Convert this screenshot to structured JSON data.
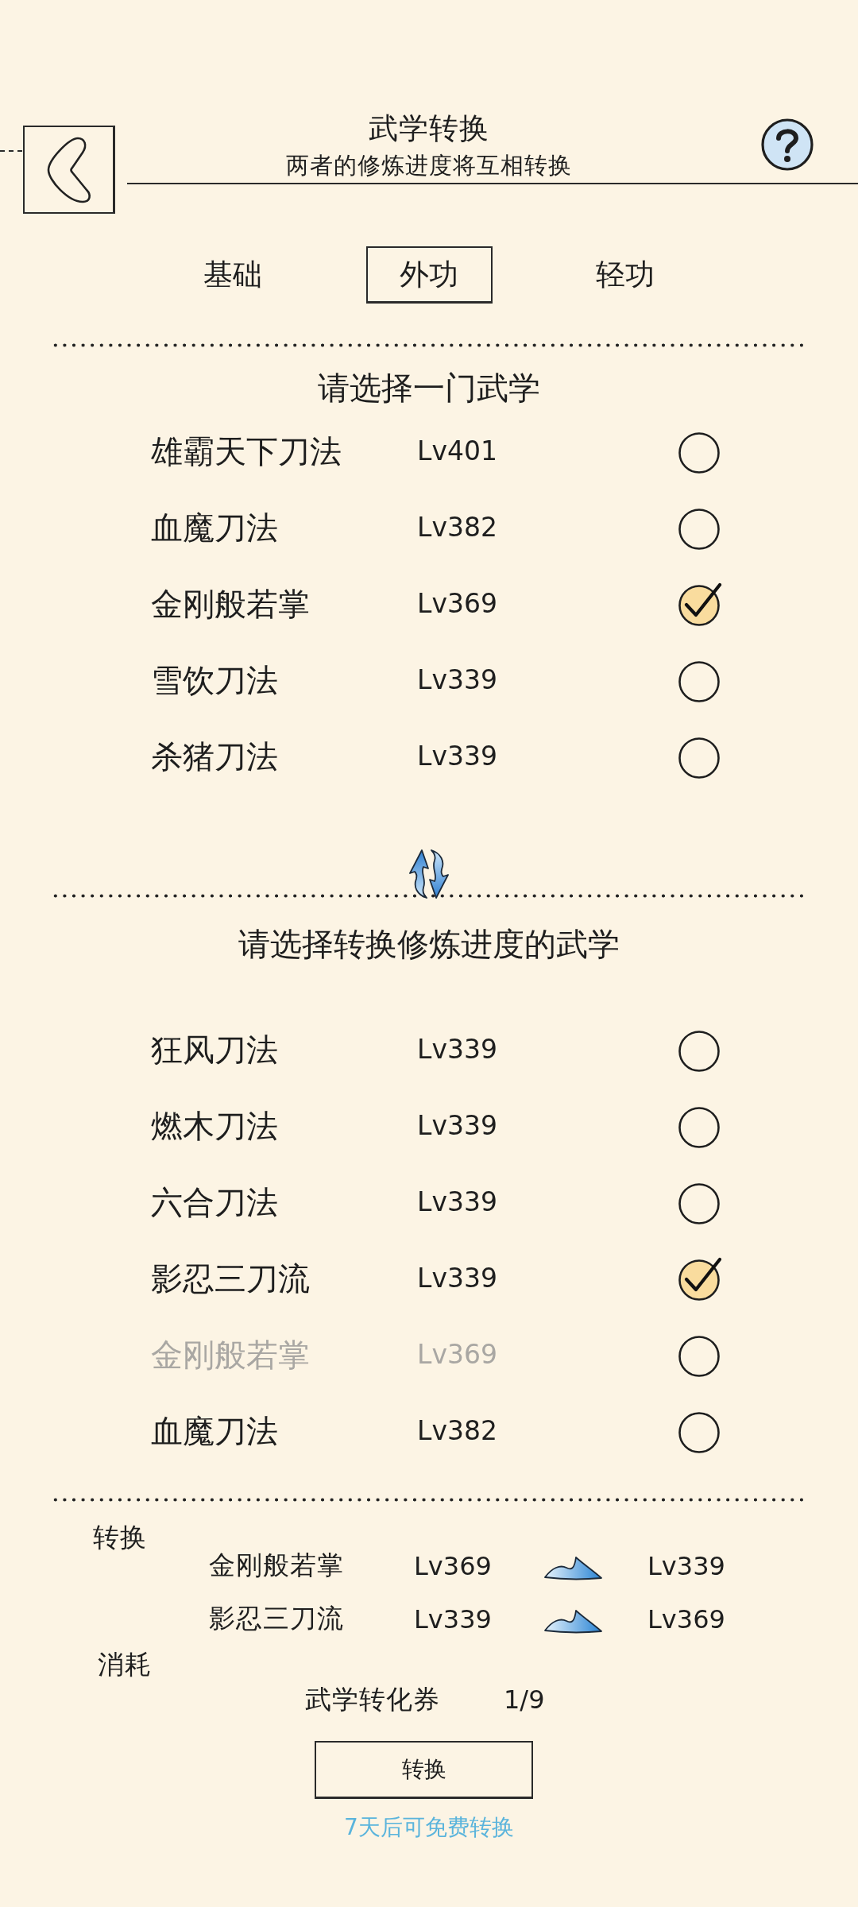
{
  "header": {
    "title": "武学转换",
    "subtitle": "两者的修炼进度将互相转换"
  },
  "tabs": [
    {
      "label": "基础",
      "selected": false
    },
    {
      "label": "外功",
      "selected": true
    },
    {
      "label": "轻功",
      "selected": false
    }
  ],
  "source_list": {
    "title": "请选择一门武学",
    "items": [
      {
        "name": "雄霸天下刀法",
        "level": "Lv401",
        "selected": false,
        "disabled": false
      },
      {
        "name": "血魔刀法",
        "level": "Lv382",
        "selected": false,
        "disabled": false
      },
      {
        "name": "金刚般若掌",
        "level": "Lv369",
        "selected": true,
        "disabled": false
      },
      {
        "name": "雪饮刀法",
        "level": "Lv339",
        "selected": false,
        "disabled": false
      },
      {
        "name": "杀猪刀法",
        "level": "Lv339",
        "selected": false,
        "disabled": false
      }
    ]
  },
  "target_list": {
    "title": "请选择转换修炼进度的武学",
    "items": [
      {
        "name": "狂风刀法",
        "level": "Lv339",
        "selected": false,
        "disabled": false
      },
      {
        "name": "燃木刀法",
        "level": "Lv339",
        "selected": false,
        "disabled": false
      },
      {
        "name": "六合刀法",
        "level": "Lv339",
        "selected": false,
        "disabled": false
      },
      {
        "name": "影忍三刀流",
        "level": "Lv339",
        "selected": true,
        "disabled": false
      },
      {
        "name": "金刚般若掌",
        "level": "Lv369",
        "selected": false,
        "disabled": true
      },
      {
        "name": "血魔刀法",
        "level": "Lv382",
        "selected": false,
        "disabled": false
      }
    ]
  },
  "conversion": {
    "label": "转换",
    "rows": [
      {
        "name": "金刚般若掌",
        "from_level": "Lv369",
        "to_level": "Lv339"
      },
      {
        "name": "影忍三刀流",
        "from_level": "Lv339",
        "to_level": "Lv369"
      }
    ]
  },
  "cost": {
    "label": "消耗",
    "item": "武学转化券",
    "count": "1/9"
  },
  "convert_button": "转换",
  "note": "7天后可免费转换"
}
